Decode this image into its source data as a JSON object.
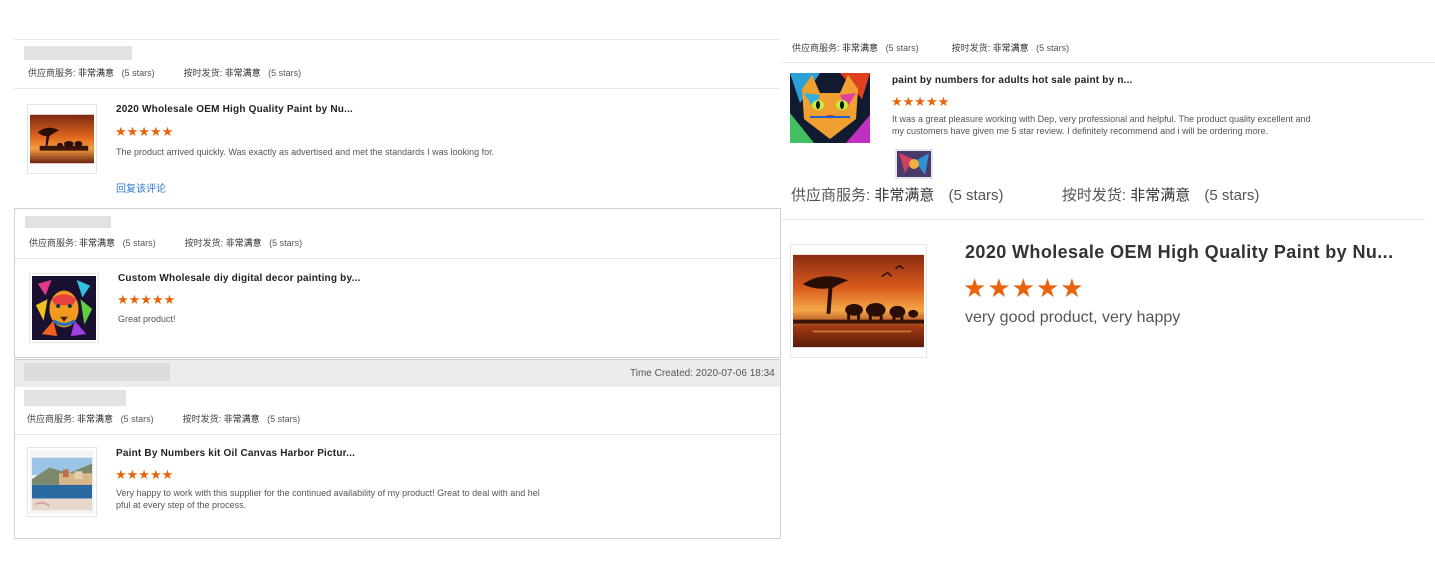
{
  "labels": {
    "supplier_service": "供应商服务:",
    "on_time_delivery": "按时发货:",
    "very_satisfied": "非常满意",
    "five_stars": "(5 stars)",
    "reply_link": "回复该评论",
    "star_glyphs": "★★★★★"
  },
  "reviews": [
    {
      "title": "2020 Wholesale OEM High Quality Paint by Nu...",
      "rating": 5,
      "comment": "The product arrived quickly. Was exactly as advertised and met the standards I was looking for."
    },
    {
      "title": "Custom Wholesale diy digital decor painting by...",
      "rating": 5,
      "comment": "Great product!"
    },
    {
      "time_created": "Time Created: 2020-07-06 18:34",
      "title": "Paint By Numbers kit Oil Canvas Harbor Pictur...",
      "rating": 5,
      "comment_line1": "Very happy to work with this supplier for the continued availability of my product! Great to deal with and hel",
      "comment_line2": "pful at every step of the process."
    },
    {
      "title": "paint by numbers for adults hot sale paint by n...",
      "rating": 5,
      "comment_line1": "It was a great pleasure working with Dep, very professional and helpful. The product quality excellent and",
      "comment_line2": "my customers have given me 5 star review. I definitely recommend and i will be ordering more."
    },
    {
      "title": "2020 Wholesale OEM High Quality Paint by Nu...",
      "rating": 5,
      "comment": "very good product, very happy"
    }
  ]
}
